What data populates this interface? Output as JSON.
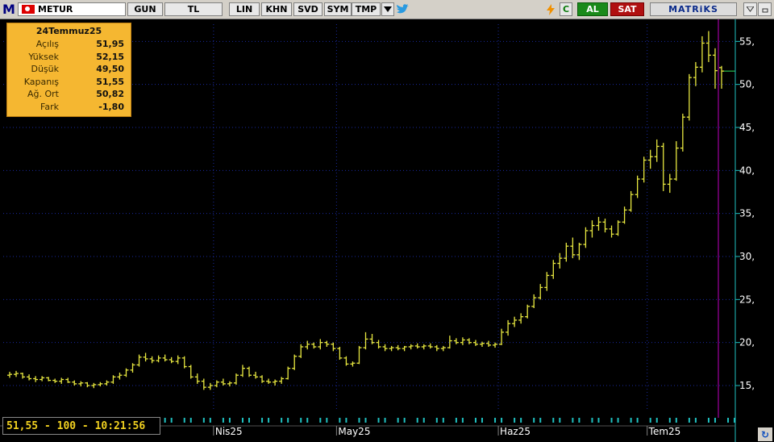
{
  "toolbar": {
    "logo": "M",
    "symbol": "METUR",
    "buttons": [
      "GUN",
      "TL",
      "LIN",
      "KHN",
      "SVD",
      "SYM",
      "TMP"
    ],
    "dropdown_icon": "triangle-down-icon",
    "twitter_icon": "bird-icon",
    "flash_icon": "lightning-icon",
    "refresh_label": "C",
    "buy_label": "AL",
    "sell_label": "SAT",
    "brand_label": "MATRiKS",
    "colors": {
      "buy": "#1a8a1a",
      "sell": "#b01010",
      "brand": "#0a2a8a"
    }
  },
  "info_box": {
    "date": "24Temmuz25",
    "rows": [
      {
        "label": "Açılış",
        "value": "51,95"
      },
      {
        "label": "Yüksek",
        "value": "52,15"
      },
      {
        "label": "Düşük",
        "value": "49,50"
      },
      {
        "label": "Kapanış",
        "value": "51,55"
      },
      {
        "label": "Ağ. Ort",
        "value": "50,82"
      },
      {
        "label": "Fark",
        "value": "-1,80"
      }
    ]
  },
  "status": {
    "text": "51,55 - 100 - 10:21:56"
  },
  "chart_data": {
    "type": "ohlc",
    "ylim": [
      12,
      57
    ],
    "y_ticks": [
      15,
      20,
      25,
      30,
      35,
      40,
      45,
      50,
      55
    ],
    "y_tick_labels": [
      "15,",
      "20,",
      "25,",
      "30,",
      "35,",
      "40,",
      "45,",
      "50,",
      "55,"
    ],
    "x_labels": [
      "Nis25",
      "May25",
      "Haz25",
      "Tem25"
    ],
    "bar_color": "#e8e840",
    "grid_color": "#1a2aa0",
    "axis_color": "#20c0c0",
    "ohlc": [
      [
        16.2,
        16.6,
        15.9,
        16.3
      ],
      [
        16.3,
        16.7,
        16.0,
        16.4
      ],
      [
        16.4,
        16.5,
        15.8,
        16.0
      ],
      [
        16.0,
        16.3,
        15.6,
        15.8
      ],
      [
        15.8,
        16.1,
        15.4,
        15.7
      ],
      [
        15.7,
        16.1,
        15.5,
        15.9
      ],
      [
        15.9,
        16.0,
        15.5,
        15.6
      ],
      [
        15.6,
        15.8,
        15.3,
        15.5
      ],
      [
        15.5,
        15.9,
        15.2,
        15.7
      ],
      [
        15.7,
        15.9,
        15.3,
        15.4
      ],
      [
        15.4,
        15.6,
        15.0,
        15.2
      ],
      [
        15.2,
        15.5,
        14.9,
        15.3
      ],
      [
        15.3,
        15.4,
        14.8,
        15.0
      ],
      [
        15.0,
        15.3,
        14.7,
        15.1
      ],
      [
        15.1,
        15.4,
        14.9,
        15.2
      ],
      [
        15.2,
        15.6,
        15.0,
        15.4
      ],
      [
        15.4,
        16.2,
        15.2,
        16.0
      ],
      [
        16.0,
        16.5,
        15.7,
        16.2
      ],
      [
        16.2,
        17.0,
        16.0,
        16.8
      ],
      [
        16.8,
        17.6,
        16.5,
        17.4
      ],
      [
        17.4,
        18.6,
        17.2,
        18.3
      ],
      [
        18.3,
        18.8,
        17.8,
        18.1
      ],
      [
        18.1,
        18.4,
        17.6,
        17.9
      ],
      [
        17.9,
        18.5,
        17.7,
        18.2
      ],
      [
        18.2,
        18.6,
        17.8,
        18.0
      ],
      [
        18.0,
        18.3,
        17.6,
        17.8
      ],
      [
        17.8,
        18.5,
        17.5,
        18.2
      ],
      [
        18.2,
        18.4,
        17.0,
        17.2
      ],
      [
        17.2,
        17.4,
        15.8,
        16.0
      ],
      [
        16.0,
        16.4,
        15.2,
        15.5
      ],
      [
        15.5,
        15.8,
        14.5,
        14.8
      ],
      [
        14.8,
        15.3,
        14.5,
        15.0
      ],
      [
        15.0,
        15.6,
        14.8,
        15.4
      ],
      [
        15.4,
        15.8,
        15.0,
        15.2
      ],
      [
        15.2,
        15.5,
        14.9,
        15.3
      ],
      [
        15.3,
        16.4,
        15.1,
        16.2
      ],
      [
        16.2,
        17.4,
        16.0,
        17.0
      ],
      [
        17.0,
        17.2,
        16.0,
        16.2
      ],
      [
        16.2,
        16.6,
        15.8,
        16.0
      ],
      [
        16.0,
        16.2,
        15.3,
        15.5
      ],
      [
        15.5,
        15.8,
        15.2,
        15.4
      ],
      [
        15.4,
        15.7,
        15.0,
        15.5
      ],
      [
        15.5,
        16.0,
        15.2,
        15.8
      ],
      [
        15.8,
        17.2,
        15.7,
        17.0
      ],
      [
        17.0,
        18.6,
        16.8,
        18.4
      ],
      [
        18.4,
        19.8,
        18.2,
        19.5
      ],
      [
        19.5,
        20.2,
        19.2,
        19.8
      ],
      [
        19.8,
        20.0,
        19.3,
        19.5
      ],
      [
        19.5,
        20.4,
        19.2,
        20.0
      ],
      [
        20.0,
        20.2,
        19.5,
        19.8
      ],
      [
        19.8,
        20.0,
        19.0,
        19.3
      ],
      [
        19.3,
        19.5,
        18.0,
        18.2
      ],
      [
        18.2,
        18.4,
        17.3,
        17.5
      ],
      [
        17.5,
        17.8,
        17.2,
        17.6
      ],
      [
        17.6,
        19.6,
        17.5,
        19.4
      ],
      [
        19.4,
        21.2,
        19.2,
        20.4
      ],
      [
        20.4,
        21.0,
        19.8,
        20.0
      ],
      [
        20.0,
        20.3,
        19.3,
        19.5
      ],
      [
        19.5,
        19.8,
        19.0,
        19.3
      ],
      [
        19.3,
        19.6,
        19.0,
        19.4
      ],
      [
        19.4,
        19.7,
        19.1,
        19.3
      ],
      [
        19.3,
        19.6,
        19.0,
        19.5
      ],
      [
        19.5,
        19.8,
        19.2,
        19.6
      ],
      [
        19.6,
        19.9,
        19.3,
        19.5
      ],
      [
        19.5,
        19.8,
        19.2,
        19.6
      ],
      [
        19.6,
        19.9,
        19.3,
        19.5
      ],
      [
        19.5,
        19.7,
        19.0,
        19.3
      ],
      [
        19.3,
        19.6,
        19.0,
        19.4
      ],
      [
        19.4,
        20.8,
        19.3,
        20.2
      ],
      [
        20.2,
        20.5,
        19.8,
        20.0
      ],
      [
        20.0,
        20.6,
        19.7,
        20.3
      ],
      [
        20.3,
        20.5,
        19.8,
        20.0
      ],
      [
        20.0,
        20.3,
        19.6,
        19.8
      ],
      [
        19.8,
        20.1,
        19.5,
        19.9
      ],
      [
        19.9,
        20.2,
        19.5,
        19.7
      ],
      [
        19.7,
        20.0,
        19.4,
        19.8
      ],
      [
        19.8,
        21.6,
        19.7,
        21.2
      ],
      [
        21.2,
        22.6,
        20.8,
        22.2
      ],
      [
        22.2,
        23.0,
        21.8,
        22.6
      ],
      [
        22.6,
        23.4,
        22.2,
        23.0
      ],
      [
        23.0,
        24.4,
        22.8,
        24.2
      ],
      [
        24.2,
        25.6,
        24.0,
        25.2
      ],
      [
        25.2,
        26.8,
        25.0,
        26.4
      ],
      [
        26.4,
        28.2,
        26.0,
        27.8
      ],
      [
        27.8,
        29.6,
        27.4,
        29.2
      ],
      [
        29.2,
        30.4,
        28.6,
        29.8
      ],
      [
        29.8,
        31.6,
        29.4,
        31.2
      ],
      [
        31.2,
        32.2,
        29.8,
        30.2
      ],
      [
        30.2,
        31.6,
        29.6,
        31.4
      ],
      [
        31.4,
        33.4,
        31.0,
        33.0
      ],
      [
        33.0,
        34.2,
        32.2,
        33.6
      ],
      [
        33.6,
        34.6,
        33.0,
        34.0
      ],
      [
        34.0,
        34.4,
        32.8,
        33.2
      ],
      [
        33.2,
        33.6,
        32.2,
        32.6
      ],
      [
        32.6,
        34.2,
        32.4,
        34.0
      ],
      [
        34.0,
        35.8,
        33.8,
        35.4
      ],
      [
        35.4,
        37.6,
        35.2,
        37.2
      ],
      [
        37.2,
        39.4,
        36.8,
        39.0
      ],
      [
        39.0,
        41.6,
        38.6,
        41.2
      ],
      [
        41.2,
        42.4,
        40.2,
        41.6
      ],
      [
        41.6,
        43.6,
        41.0,
        42.8
      ],
      [
        42.8,
        43.2,
        37.6,
        38.4
      ],
      [
        38.4,
        39.6,
        37.4,
        39.0
      ],
      [
        39.0,
        43.4,
        38.8,
        42.6
      ],
      [
        42.6,
        46.6,
        42.2,
        46.2
      ],
      [
        46.2,
        51.2,
        45.8,
        50.8
      ],
      [
        50.8,
        52.6,
        49.8,
        52.0
      ],
      [
        52.0,
        55.6,
        51.4,
        54.8
      ],
      [
        54.8,
        56.2,
        52.6,
        53.4
      ],
      [
        53.4,
        54.2,
        49.5,
        51.6
      ],
      [
        51.95,
        52.15,
        49.5,
        51.55
      ]
    ],
    "volume_ticks": [
      0,
      1,
      2,
      3,
      4,
      5,
      6,
      7,
      8,
      9,
      10,
      11,
      12,
      13,
      14,
      15,
      16,
      17,
      18,
      19,
      20,
      21,
      22,
      23,
      24,
      25,
      26,
      27,
      28,
      29,
      30,
      31,
      32,
      33,
      34,
      35,
      36,
      37,
      38,
      39,
      40,
      41,
      42,
      43,
      44,
      45,
      46,
      47,
      48,
      49,
      50,
      51,
      52,
      53,
      54,
      55,
      56,
      57,
      58,
      59,
      60,
      61,
      62,
      63,
      64,
      65,
      66,
      67,
      68,
      69,
      70,
      71,
      72,
      73,
      74,
      75,
      76,
      77,
      78,
      79,
      80,
      81,
      82,
      83,
      84,
      85,
      86,
      87,
      88,
      89,
      90,
      91,
      92,
      93,
      94,
      95,
      96,
      97,
      98,
      99,
      100,
      101,
      102,
      103,
      104,
      105,
      106,
      107,
      108,
      109,
      110,
      111,
      112
    ],
    "x_label_index": [
      32,
      51,
      76,
      99
    ]
  }
}
